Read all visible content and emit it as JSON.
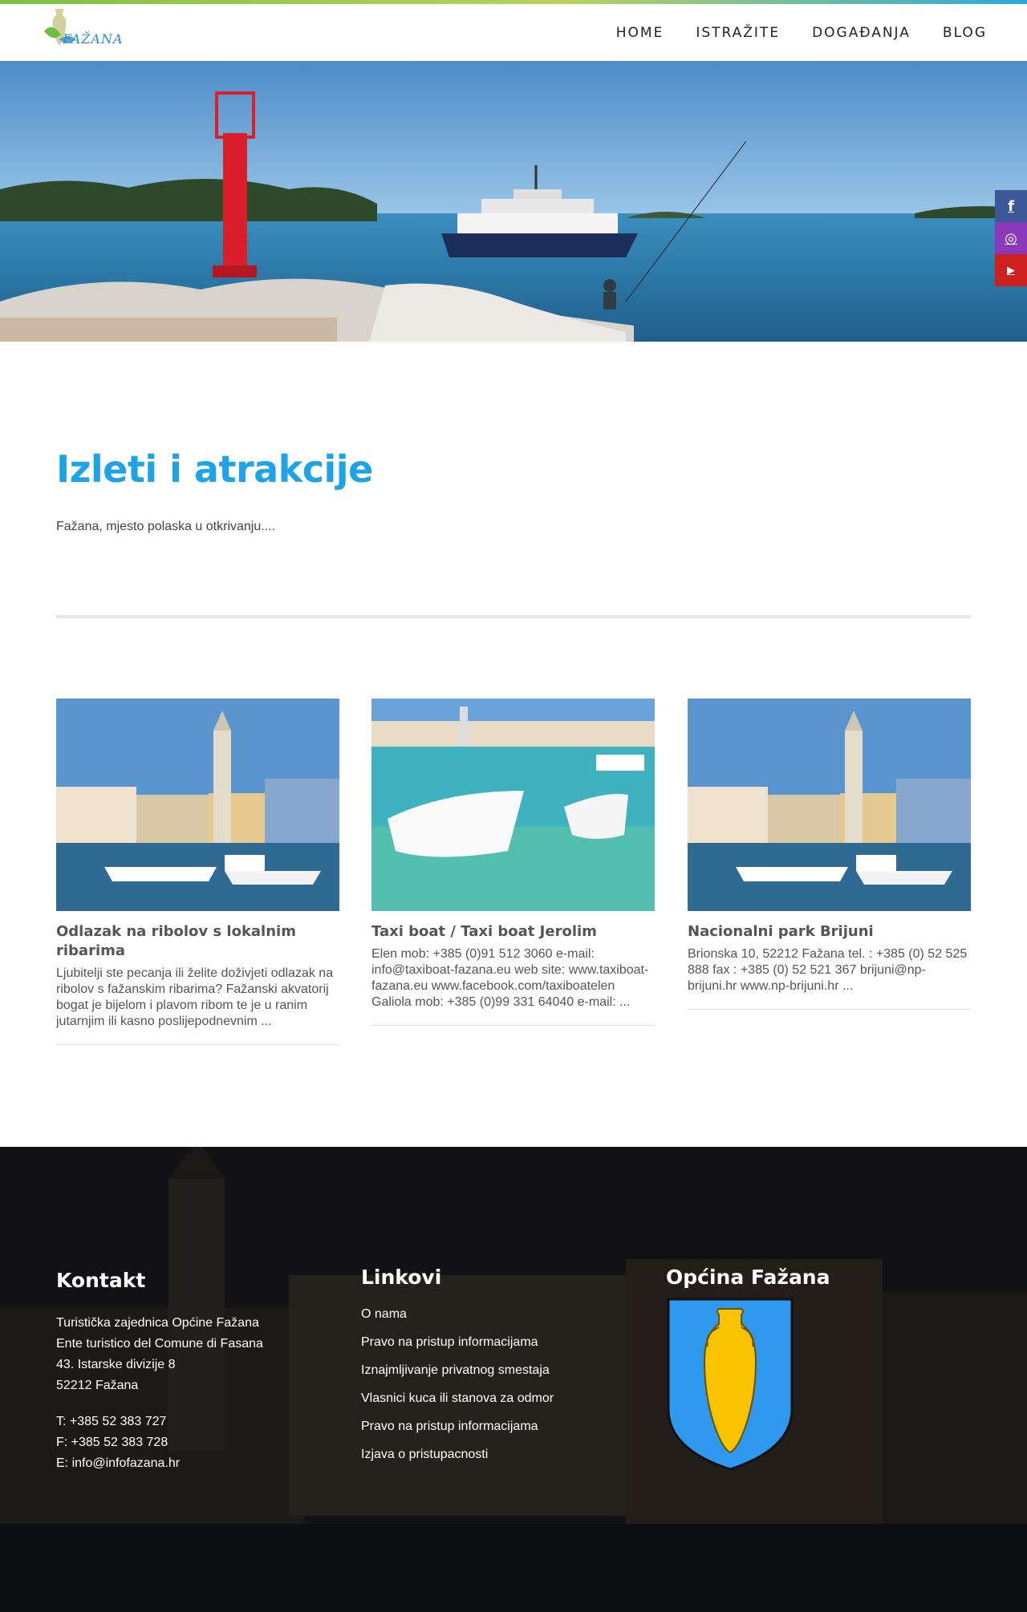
{
  "brand": {
    "logo_text": "FAŽANA"
  },
  "nav": {
    "items": [
      "HOME",
      "ISTRAŽITE",
      "DOGAĐANJA",
      "BLOG"
    ]
  },
  "social": {
    "facebook": "f",
    "instagram": "◎",
    "youtube": "▶"
  },
  "intro": {
    "title": "Izleti i atrakcije",
    "subtitle": "Fažana, mjesto polaska u otkrivanju...."
  },
  "cards": [
    {
      "title": "Odlazak na ribolov s lokalnim ribarima",
      "text": "Ljubitelji ste pecanja ili želite doživjeti odlazak na ribolov s fažanskim ribarima? Fažanski akvatorij bogat je bijelom i plavom ribom te je u ranim jutarnjim ili kasno poslijepodnevnim ..."
    },
    {
      "title": "Taxi boat / Taxi boat Jerolim",
      "text": "Elen mob: +385 (0)91 512 3060 e-mail: info@taxiboat-fazana.eu web site: www.taxiboat-fazana.eu www.facebook.com/taxiboatelen Galiola mob: +385 (0)99 331 64040 e-mail: ..."
    },
    {
      "title": "Nacionalni park Brijuni",
      "text": "Brionska 10, 52212 Fažana tel. : +385 (0) 52 525 888 fax : +385 (0) 52 521 367 brijuni@np-brijuni.hr www.np-brijuni.hr ..."
    }
  ],
  "footer": {
    "contact": {
      "title": "Kontakt",
      "lines": [
        "Turistička zajednica Općine Fažana",
        "Ente turistico del Comune di Fasana",
        "43. Istarske divizije 8",
        "52212 Fažana"
      ],
      "phone": "T: +385 52 383 727",
      "fax": "F: +385 52 383 728",
      "email": "E: info@infofazana.hr"
    },
    "links": {
      "title": "Linkovi",
      "items": [
        "O nama",
        "Pravo na pristup informacijama",
        "Iznajmljivanje privatnog smestaja",
        "Vlasnici kuca ili stanova za odmor",
        "Pravo na pristup informacijama",
        "Izjava o pristupacnosti"
      ]
    },
    "municipality": {
      "title": "Općina Fažana"
    }
  },
  "colors": {
    "accent": "#1ea3e6",
    "facebook": "#3b5998",
    "instagram": "#8a3ab9",
    "youtube": "#cd201f",
    "footer_bg": "#1c1c22"
  }
}
